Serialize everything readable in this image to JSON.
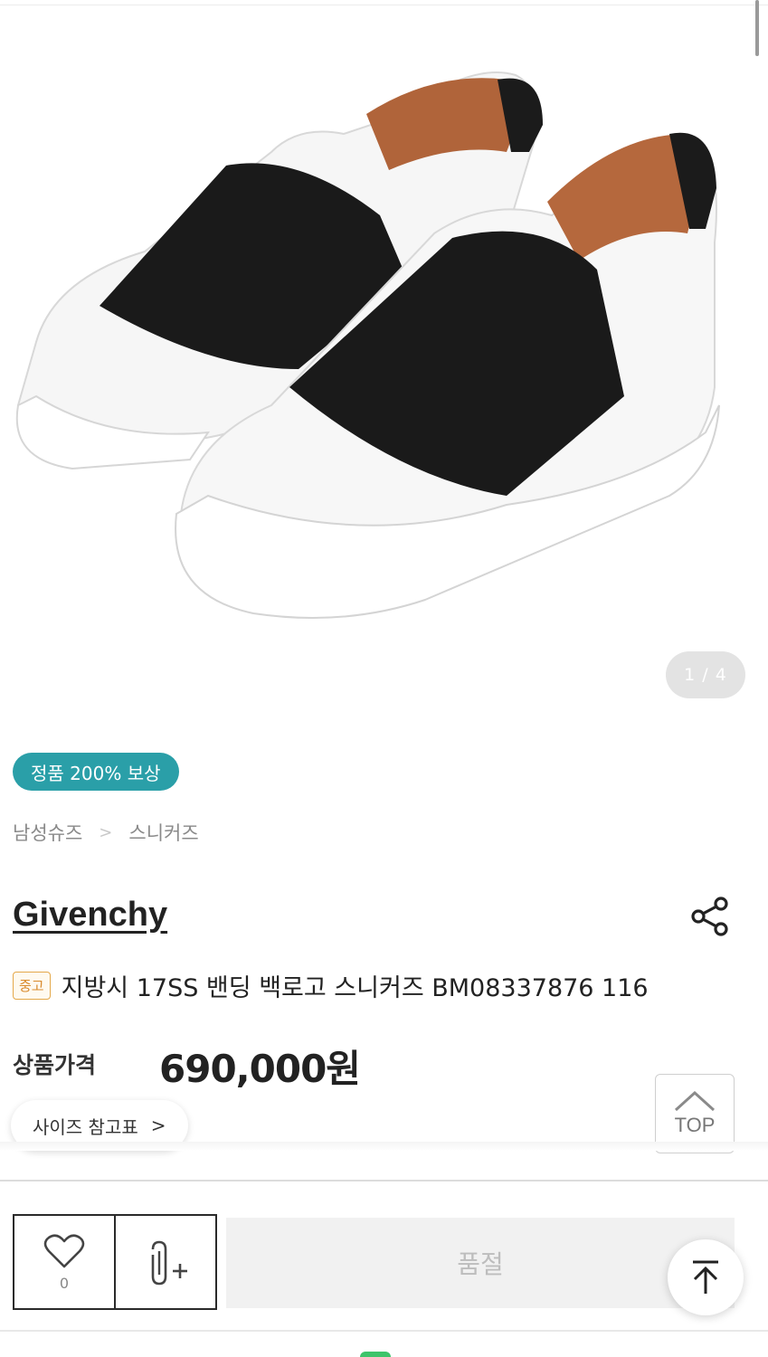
{
  "gallery": {
    "page_indicator": "1 / 4",
    "image_alt": "white slip-on sneakers with black elastic band"
  },
  "auth_badge": "정품 200% 보상",
  "breadcrumb": {
    "items": [
      "남성슈즈",
      "스니커즈"
    ],
    "separator": ">"
  },
  "product": {
    "brand": "Givenchy",
    "condition_badge": "중고",
    "title": "지방시 17SS 밴딩 백로고 스니커즈 BM08337876 116",
    "price_label": "상품가격",
    "price": "690,000원"
  },
  "size_guide": {
    "label": "사이즈 참고표",
    "chevron": ">"
  },
  "top_button": {
    "label": "TOP"
  },
  "bottom_bar": {
    "wish_count": "0",
    "soldout_label": "품절"
  },
  "icons": {
    "share": "share-icon",
    "heart": "heart-icon",
    "attach": "paperclip-plus-icon",
    "scroll_top": "arrow-up-to-line-icon"
  },
  "colors": {
    "auth_badge_bg": "#2a9fa8",
    "condition_badge": "#d98a2c",
    "soldout_bg": "#f1f1f1"
  }
}
